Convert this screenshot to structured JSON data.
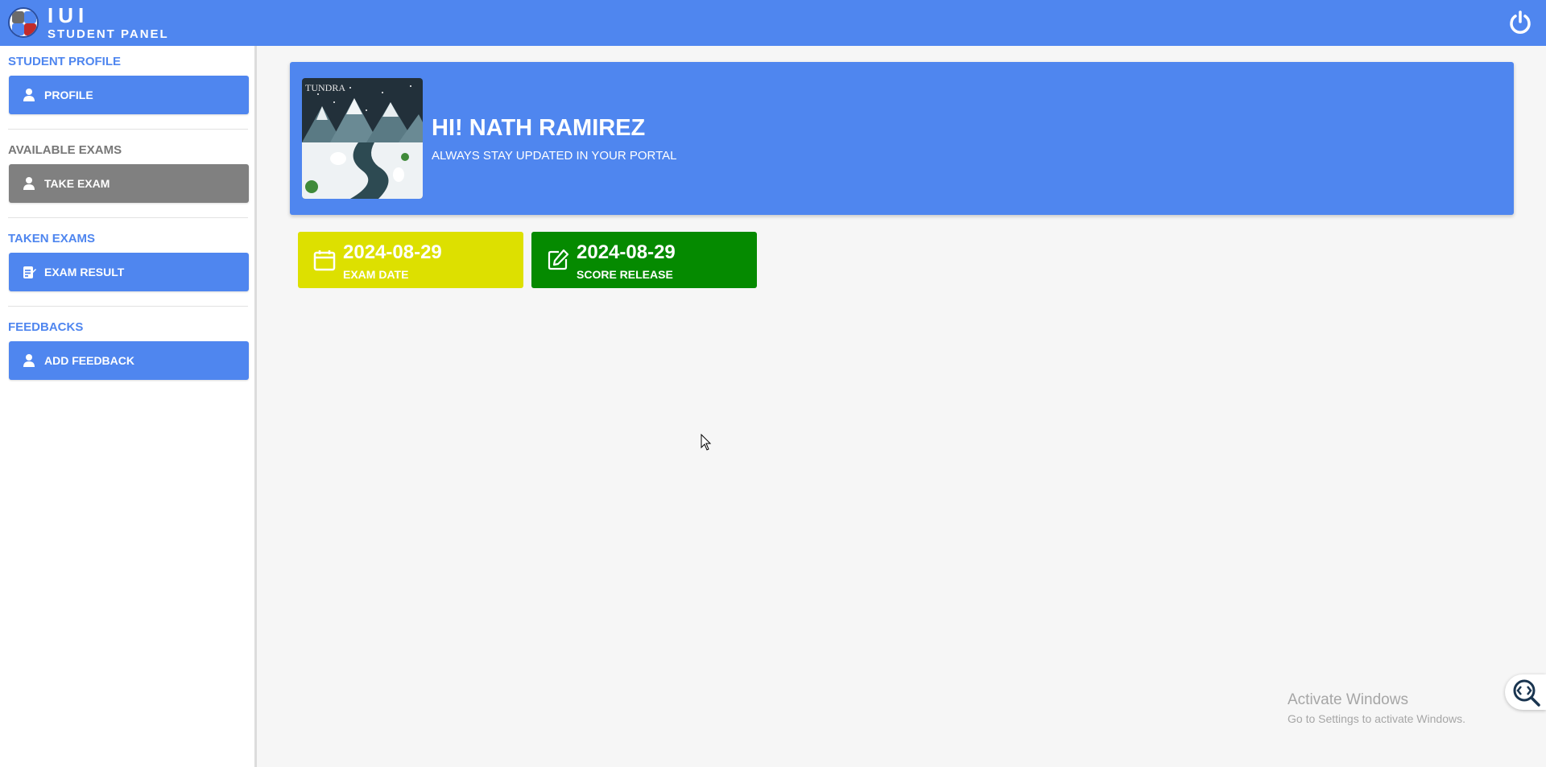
{
  "header": {
    "brand_name": "IUI",
    "brand_sub": "STUDENT PANEL",
    "logo_icon": "school-logo",
    "power_icon": "power-icon",
    "color": "#4f86ef"
  },
  "sidebar": {
    "sections": [
      {
        "title": "STUDENT PROFILE",
        "button": "PROFILE",
        "icon": "user-icon"
      },
      {
        "title": "AVAILABLE EXAMS",
        "button": "TAKE EXAM",
        "icon": "user-icon"
      },
      {
        "title": "TAKEN EXAMS",
        "button": "EXAM RESULT",
        "icon": "clipboard-icon"
      },
      {
        "title": "FEEDBACKS",
        "button": "ADD FEEDBACK",
        "icon": "user-icon"
      }
    ]
  },
  "hero": {
    "greeting": "HI! NATH RAMIREZ",
    "tagline": "ALWAYS STAY UPDATED IN YOUR PORTAL",
    "avatar_text": "TUNDRA"
  },
  "cards": [
    {
      "date": "2024-08-29",
      "label": "EXAM DATE",
      "icon": "calendar-icon",
      "color": "#dde000"
    },
    {
      "date": "2024-08-29",
      "label": "SCORE RELEASE",
      "icon": "edit-icon",
      "color": "#058a00"
    }
  ],
  "watermark": {
    "line1": "Activate Windows",
    "line2": "Go to Settings to activate Windows."
  }
}
